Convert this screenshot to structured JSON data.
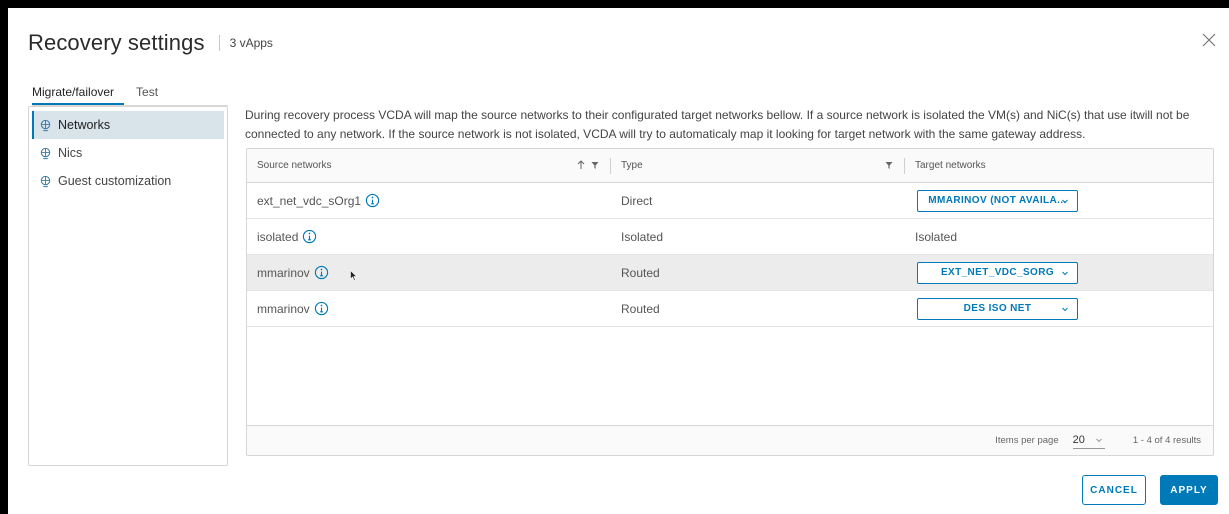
{
  "header": {
    "title": "Recovery settings",
    "subtitle": "3 vApps"
  },
  "tabs": [
    {
      "label": "Migrate/failover",
      "active": true
    },
    {
      "label": "Test",
      "active": false
    }
  ],
  "sidebar": {
    "items": [
      {
        "label": "Networks",
        "icon": "network-icon",
        "active": true
      },
      {
        "label": "Nics",
        "icon": "network-icon",
        "active": false
      },
      {
        "label": "Guest customization",
        "icon": "network-icon",
        "active": false
      }
    ]
  },
  "description": "During recovery process VCDA will map the source networks to their configurated target networks bellow. If a source network is isolated the VM(s) and NiC(s) that use itwill not be connected to any network. If the source network is not isolated, VCDA will try to automaticaly map it looking for target network with the same gateway address.",
  "grid": {
    "columns": [
      "Source networks",
      "Type",
      "Target networks"
    ],
    "rows": [
      {
        "source": "ext_net_vdc_sOrg1",
        "type": "Direct",
        "target": "MMARINOV (NOT AVAILA...",
        "target_is_select": true,
        "highlighted": false
      },
      {
        "source": "isolated",
        "type": "Isolated",
        "target": "Isolated",
        "target_is_select": false,
        "highlighted": false
      },
      {
        "source": "mmarinov",
        "type": "Routed",
        "target": "EXT_NET_VDC_SORG",
        "target_is_select": true,
        "highlighted": true
      },
      {
        "source": "mmarinov",
        "type": "Routed",
        "target": "DES ISO NET",
        "target_is_select": true,
        "highlighted": false
      }
    ],
    "footer": {
      "items_per_page_label": "Items per page",
      "items_per_page_value": "20",
      "results": "1 - 4 of 4 results"
    }
  },
  "actions": {
    "cancel": "CANCEL",
    "apply": "APPLY"
  },
  "colors": {
    "accent": "#0079b8",
    "selected_nav": "#d8e3ea"
  }
}
